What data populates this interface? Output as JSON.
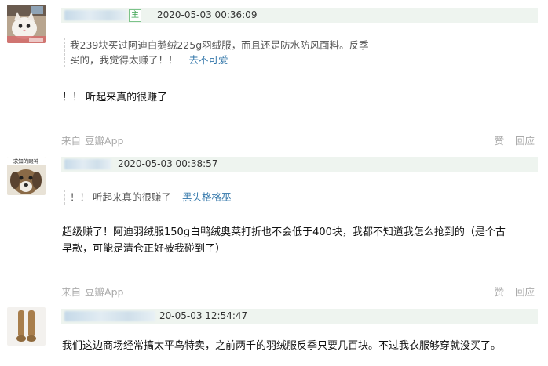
{
  "comments": [
    {
      "avatar_icon": "cat-avatar-icon",
      "timestamp": "2020-05-03 00:36:09",
      "owner_badge": "主",
      "quote_text_line1": "我239块买过阿迪白鹅绒225g羽绒服，而且还是防水防风面料。反季",
      "quote_text_line2": "买的，我觉得太赚了！！",
      "quote_author": "去不可爱",
      "text": "！！ 听起来真的很赚了",
      "source_prefix": "来自",
      "source_app": "豆瓣App",
      "like_label": "赞",
      "reply_label": "回应"
    },
    {
      "avatar_icon": "dog-avatar-icon",
      "avatar_caption": "求知的眼神",
      "timestamp": "2020-05-03 00:38:57",
      "quote_text_line1": "！！ 听起来真的很赚了",
      "quote_author": "黑头格格巫",
      "text_line1": "超级赚了！阿迪羽绒服150g白鸭绒奥莱打折也不会低于400块，我都不知道我怎么抢到的（是个古",
      "text_line2": "早款，可能是清仓正好被我碰到了）",
      "source_prefix": "来自",
      "source_app": "豆瓣App",
      "like_label": "赞",
      "reply_label": "回应"
    },
    {
      "avatar_icon": "paw-avatar-icon",
      "timestamp": "20-05-03 12:54:47",
      "text": "我们这边商场经常搞太平鸟特卖，之前两千的羽绒服反季只要几百块。不过我衣服够穿就没买了。"
    }
  ]
}
